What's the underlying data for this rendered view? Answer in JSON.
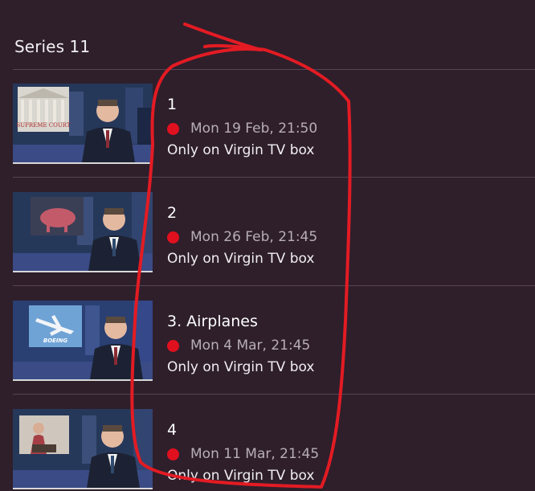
{
  "series": {
    "title": "Series 11"
  },
  "episodes": [
    {
      "title": "1",
      "time": "Mon 19 Feb, 21:50",
      "note": "Only on Virgin TV box",
      "thumb_caption": "SUPREME COURT"
    },
    {
      "title": "2",
      "time": "Mon 26 Feb, 21:45",
      "note": "Only on Virgin TV box",
      "thumb_caption": ""
    },
    {
      "title": "3. Airplanes",
      "time": "Mon 4 Mar, 21:45",
      "note": "Only on Virgin TV box",
      "thumb_caption": "BOEING"
    },
    {
      "title": "4",
      "time": "Mon 11 Mar, 21:45",
      "note": "Only on Virgin TV box",
      "thumb_caption": ""
    }
  ],
  "colors": {
    "background": "#2e1f2b",
    "record_dot": "#e0101f",
    "annotation": "#e31b23"
  },
  "icons": {
    "record": "record-dot-icon"
  }
}
